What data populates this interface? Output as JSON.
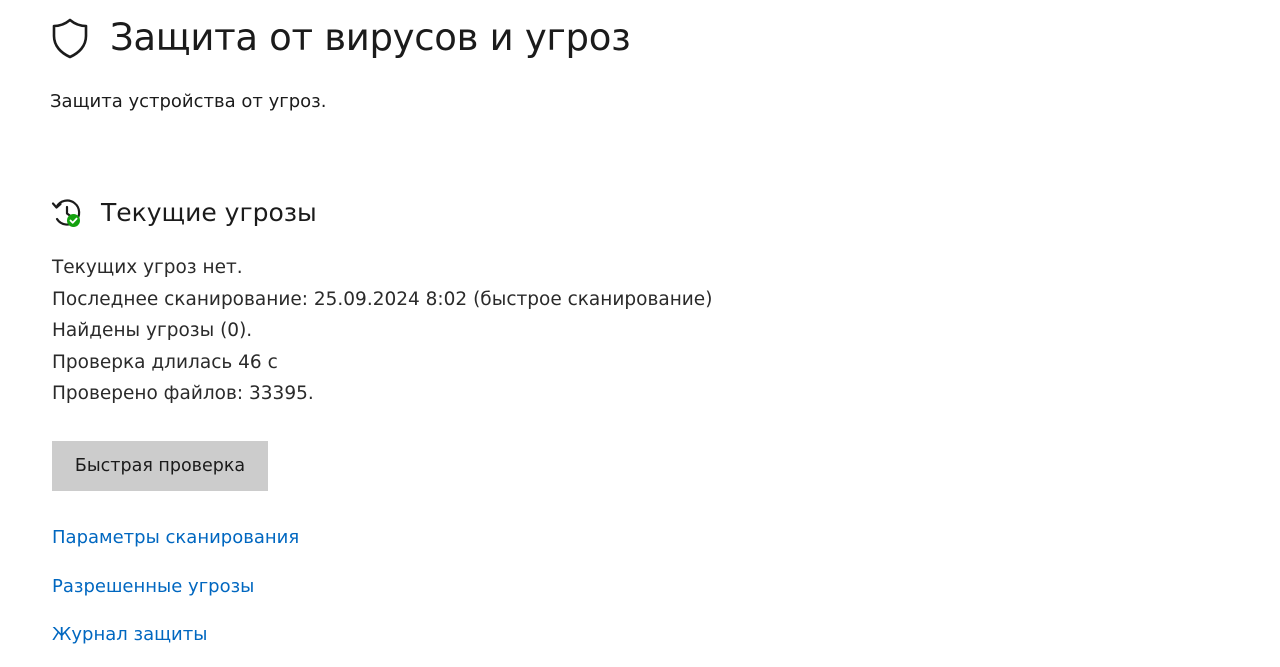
{
  "header": {
    "title": "Защита от вирусов и угроз",
    "subtitle": "Защита устройства от угроз.",
    "icon": "shield-icon"
  },
  "current_threats": {
    "title": "Текущие угрозы",
    "icon": "history-check-icon",
    "icon_accent_color": "#13a10e",
    "status_lines": [
      "Текущих угроз нет.",
      "Последнее сканирование: 25.09.2024 8:02 (быстрое сканирование)",
      "Найдены угрозы (0).",
      "Проверка длилась 46 с",
      "Проверено файлов: 33395."
    ],
    "quick_scan_label": "Быстрая проверка"
  },
  "links": {
    "scan_options": "Параметры сканирования",
    "allowed_threats": "Разрешенные угрозы",
    "protection_history": "Журнал защиты"
  },
  "colors": {
    "link": "#0067c0",
    "button_bg": "#cccccc",
    "text": "#1b1b1b"
  }
}
